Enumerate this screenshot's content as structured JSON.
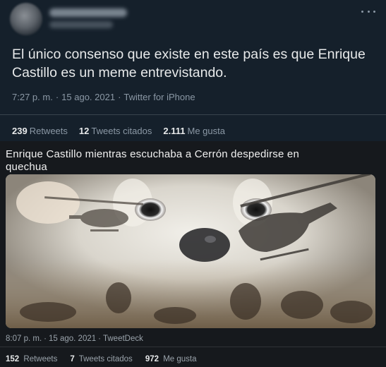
{
  "tweet": {
    "text": "El único consenso que existe en este país es que Enrique Castillo es un meme entrevistando.",
    "time": "7:27 p. m.",
    "date": "15 ago. 2021",
    "source": "Twitter for iPhone",
    "separator": "·",
    "stats": [
      {
        "count": "239",
        "label": "Retweets"
      },
      {
        "count": "12",
        "label": "Tweets citados"
      },
      {
        "count": "2.111",
        "label": "Me gusta"
      }
    ],
    "more_icon": "more-horizontal-icon"
  },
  "embedded": {
    "caption": "Enrique Castillo mientras escuchaba a Cerrón despedirse en quechua",
    "time": "8:07 p. m.",
    "date": "15 ago. 2021",
    "source": "TweetDeck",
    "separator": "·",
    "stats": [
      {
        "count": "152",
        "label": "Retweets"
      },
      {
        "count": "7",
        "label": "Tweets citados"
      },
      {
        "count": "972",
        "label": "Me gusta"
      }
    ]
  },
  "colors": {
    "background": "#15202b",
    "text": "#e7e9ea",
    "muted": "#8b98a5",
    "divider": "#38444d"
  }
}
